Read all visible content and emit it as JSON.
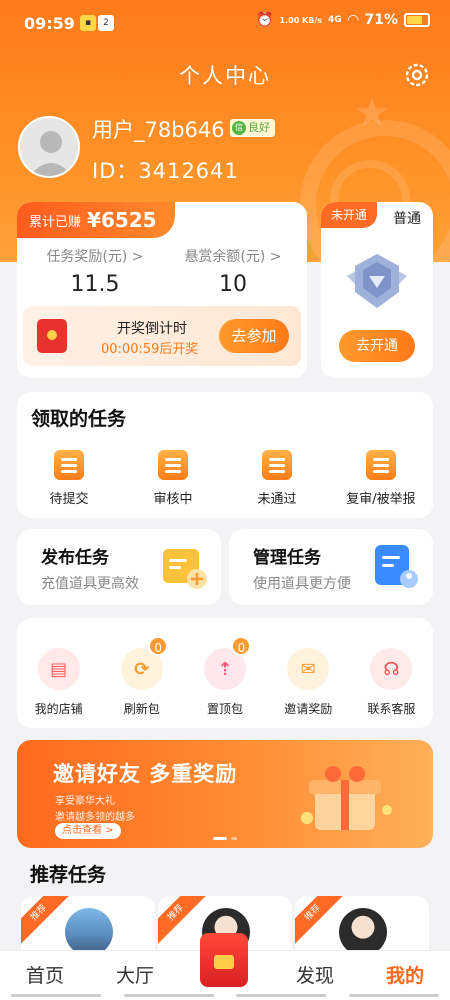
{
  "status": {
    "time": "09:59",
    "net": "1.00 KB/s",
    "signal": "4G",
    "battery": "71%"
  },
  "header": {
    "title": "个人中心"
  },
  "user": {
    "name": "用户_78b646",
    "badge": "良好",
    "id_label": "ID：3412641"
  },
  "earnings": {
    "total_label": "累计已赚",
    "currency": "¥",
    "total_value": "6525",
    "task_reward_label": "任务奖励(元) >",
    "task_reward_value": "11.5",
    "bounty_label": "悬赏余额(元) >",
    "bounty_value": "10",
    "lottery_title": "开奖倒计时",
    "lottery_time": "00:00:59后开奖",
    "join_button": "去参加"
  },
  "vip": {
    "tag": "未开通",
    "level": "普通",
    "open_button": "去开通"
  },
  "tasks": {
    "title": "领取的任务",
    "items": [
      {
        "label": "待提交",
        "icon": "wallet-icon"
      },
      {
        "label": "审核中",
        "icon": "review-icon"
      },
      {
        "label": "未通过",
        "icon": "rejected-icon"
      },
      {
        "label": "复审/被举报",
        "icon": "reexamine-icon"
      }
    ]
  },
  "publish": {
    "title": "发布任务",
    "subtitle": "充值道具更高效"
  },
  "manage": {
    "title": "管理任务",
    "subtitle": "使用道具更方便"
  },
  "tools": [
    {
      "label": "我的店铺",
      "icon": "shop-icon",
      "badge": "",
      "color": "#ff5a5a",
      "bg": "#ffe9e9"
    },
    {
      "label": "刷新包",
      "icon": "refresh-icon",
      "badge": "0",
      "color": "#ff9a2e",
      "bg": "#fff3de"
    },
    {
      "label": "置顶包",
      "icon": "pin-top-icon",
      "badge": "0",
      "color": "#ff5a7a",
      "bg": "#ffe7ee"
    },
    {
      "label": "邀请奖励",
      "icon": "invite-mail-icon",
      "badge": "",
      "color": "#ff9a2e",
      "bg": "#fff3de"
    },
    {
      "label": "联系客服",
      "icon": "service-icon",
      "badge": "",
      "color": "#ff4a4a",
      "bg": "#ffe9e9"
    }
  ],
  "banner": {
    "title": "邀请好友 多重奖励",
    "line1": "享受豪华大礼",
    "line2": "邀请越多领的越多",
    "cta": "点击查看 >"
  },
  "recommend": {
    "title": "推荐任务",
    "ribbon": "推荐"
  },
  "tabbar": {
    "home": "首页",
    "hall": "大厅",
    "discover": "发现",
    "mine": "我的"
  }
}
